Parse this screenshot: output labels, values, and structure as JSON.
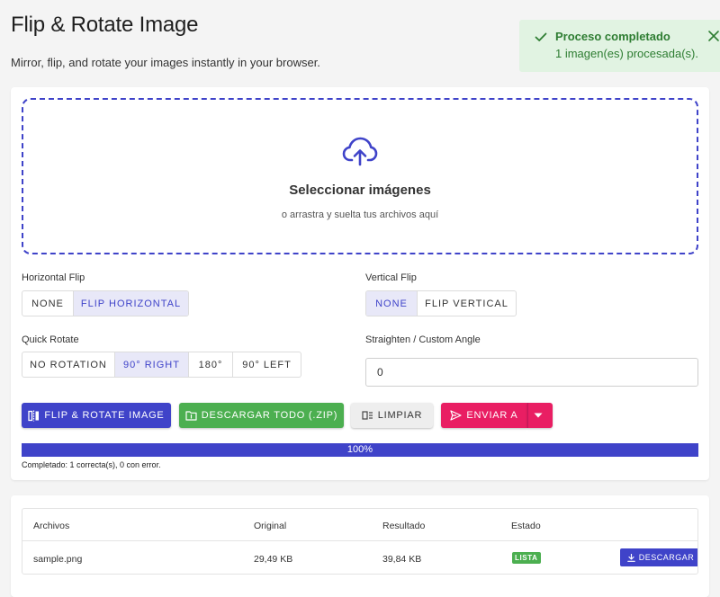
{
  "header": {
    "title": "Flip & Rotate Image",
    "subtitle": "Mirror, flip, and rotate your images instantly in your browser."
  },
  "toast": {
    "title": "Proceso completado",
    "message": "1 imagen(es) procesada(s).",
    "icon": "check-icon",
    "close_icon": "close-icon",
    "color": "#2e7d32",
    "background": "#e1f3e2"
  },
  "dropzone": {
    "title": "Seleccionar imágenes",
    "subtitle": "o arrastra y suelta tus archivos aquí",
    "icon": "cloud-upload-icon"
  },
  "horizontal_flip": {
    "label": "Horizontal Flip",
    "options": [
      "NONE",
      "FLIP HORIZONTAL"
    ],
    "selected": "FLIP HORIZONTAL"
  },
  "vertical_flip": {
    "label": "Vertical Flip",
    "options": [
      "NONE",
      "FLIP VERTICAL"
    ],
    "selected": "NONE"
  },
  "quick_rotate": {
    "label": "Quick Rotate",
    "options": [
      "NO ROTATION",
      "90° RIGHT",
      "180°",
      "90° LEFT"
    ],
    "selected": "90° RIGHT"
  },
  "custom_angle": {
    "label": "Straighten / Custom Angle",
    "value": "0"
  },
  "actions": {
    "process": "FLIP & ROTATE IMAGE",
    "download_all": "DESCARGAR TODO (.ZIP)",
    "clear": "LIMPIAR",
    "send_to": "ENVIAR A"
  },
  "progress": {
    "percent": 100,
    "label": "100%",
    "status": "Completado: 1 correcta(s), 0 con error."
  },
  "results": {
    "columns": [
      "Archivos",
      "Original",
      "Resultado",
      "Estado"
    ],
    "rows": [
      {
        "file": "sample.png",
        "original": "29,49 KB",
        "result": "39,84 KB",
        "status": "LISTA",
        "action": "DESCARGAR"
      }
    ]
  },
  "colors": {
    "primary": "#3f43c9",
    "success": "#4caf50",
    "accent": "#e91e63"
  }
}
